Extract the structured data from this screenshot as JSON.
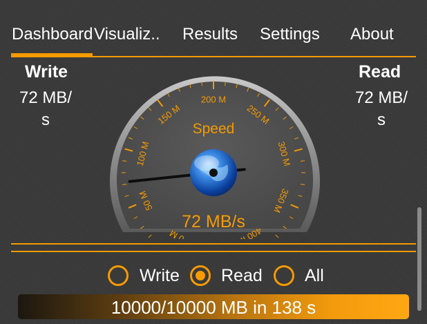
{
  "tabs": [
    {
      "label": "Dashboard"
    },
    {
      "label": "Visualiz.."
    },
    {
      "label": "Results"
    },
    {
      "label": "Settings"
    },
    {
      "label": "About"
    }
  ],
  "write": {
    "label": "Write",
    "value_line1": "72 MB/",
    "value_line2": "s"
  },
  "read": {
    "label": "Read",
    "value_line1": "72 MB/",
    "value_line2": "s"
  },
  "gauge": {
    "title": "Speed",
    "readout": "72 MB/s",
    "ticks": [
      "0 M",
      "50 M",
      "100 M",
      "150 M",
      "200 M",
      "250 M",
      "300 M",
      "350 M",
      "400 M"
    ],
    "value_mb_s": 72,
    "max_mb_s": 400
  },
  "mode": {
    "options": [
      "Write",
      "Read",
      "All"
    ],
    "selected": "Read"
  },
  "progress": {
    "text": "10000/10000 MB in 138 s",
    "fraction": 1.0
  },
  "colors": {
    "accent": "#f59b00",
    "background": "#393939",
    "text": "#ffffff"
  }
}
